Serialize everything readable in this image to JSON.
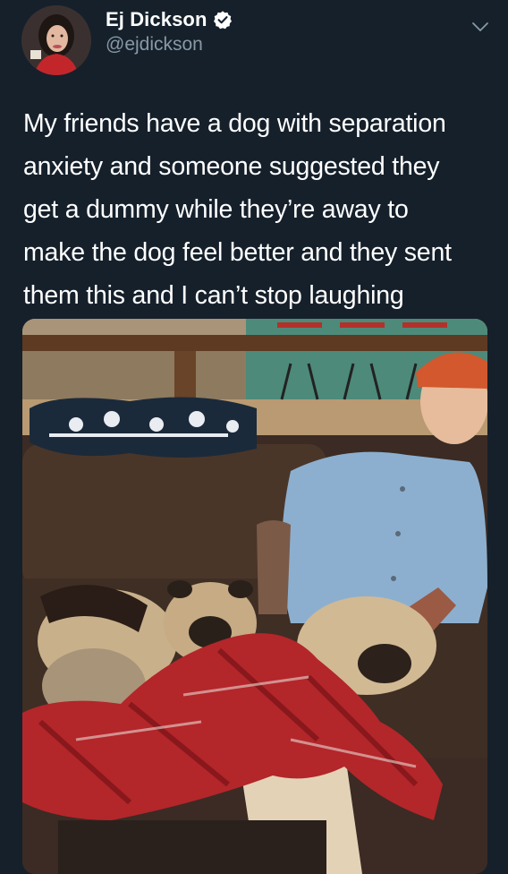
{
  "author": {
    "display_name": "Ej Dickson",
    "handle": "@ejdickson",
    "verified": true,
    "avatar_icon": "profile-photo"
  },
  "tweet": {
    "text": "My friends have a dog with separation\nanxiety and someone suggested they\nget a dummy while they’re away to\nmake the dog feel better and they sent\nthem this and I can’t stop laughing"
  },
  "media": {
    "type": "photo",
    "description_icon": "attached-photo"
  },
  "colors": {
    "background": "#15202b",
    "text_primary": "#ffffff",
    "text_secondary": "#8899a6",
    "verified_badge": "#ffffff"
  }
}
